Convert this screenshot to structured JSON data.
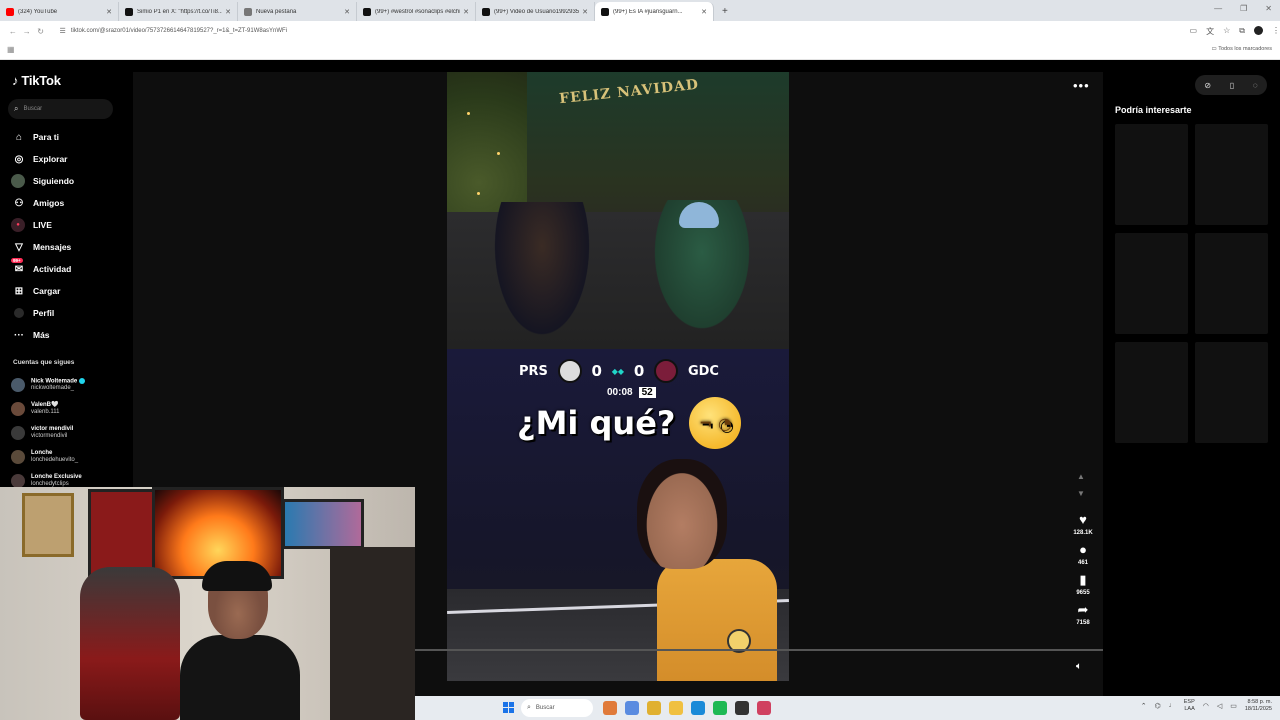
{
  "browser": {
    "tabs": [
      {
        "title": "(324) YouTube",
        "favicon_color": "#ff0000"
      },
      {
        "title": "Simio P1 en X: \"https://t.co/Ti8...",
        "favicon_color": "#111111"
      },
      {
        "title": "Nueva pestaña",
        "favicon_color": "#777777"
      },
      {
        "title": "(99+) #westrol #sonaclips #elchi...",
        "favicon_color": "#111111"
      },
      {
        "title": "(99+) Video de Usuario1992935...",
        "favicon_color": "#111111"
      },
      {
        "title": "(99+) Es IA #juansguarn...",
        "favicon_color": "#111111"
      }
    ],
    "url": "tiktok.com/@srazor01/video/7573726614647819527?_r=1&_t=ZT-91W8asYnWFi",
    "bookmarks_all": "Todos los marcadores"
  },
  "tiktok": {
    "logo": "TikTok",
    "search_placeholder": "Buscar",
    "nav": [
      {
        "label": "Para ti",
        "icon": "home-icon"
      },
      {
        "label": "Explorar",
        "icon": "compass-icon"
      },
      {
        "label": "Siguiendo",
        "icon": "avatar"
      },
      {
        "label": "Amigos",
        "icon": "friends-icon"
      },
      {
        "label": "LIVE",
        "icon": "live-icon"
      },
      {
        "label": "Mensajes",
        "icon": "messages-icon"
      },
      {
        "label": "Actividad",
        "icon": "inbox-icon",
        "badge": "99+"
      },
      {
        "label": "Cargar",
        "icon": "upload-icon"
      },
      {
        "label": "Perfil",
        "icon": "profile-icon"
      },
      {
        "label": "Más",
        "icon": "more-icon"
      }
    ],
    "following_title": "Cuentas que sigues",
    "following": [
      {
        "name": "Nick Woltemade",
        "handle": "nickwoltemade_",
        "verified": true
      },
      {
        "name": "ValenB🤍",
        "handle": "valenb.111",
        "verified": false
      },
      {
        "name": "victor mendivil",
        "handle": "victormendivil",
        "verified": false
      },
      {
        "name": "Lonche",
        "handle": "lonchedehuevito_",
        "verified": false
      },
      {
        "name": "Lonche Exclusive",
        "handle": "lonchedytclips",
        "verified": false
      }
    ],
    "video": {
      "banner": "FELIZ NAVIDAD",
      "score": {
        "home": "PRS",
        "home_goals": "0",
        "away_goals": "0",
        "away": "GDC"
      },
      "clock": "00:08",
      "shot_clock": "52",
      "caption": "¿Mi qué?",
      "progress": 0.0
    },
    "actions": {
      "likes": "128.1K",
      "comments": "461",
      "saves": "9655",
      "shares": "7158"
    },
    "right_title": "Podría interesarte",
    "suggested_count": 6
  },
  "taskbar": {
    "search": "Buscar",
    "lang_top": "ESP",
    "lang_bottom": "LAA",
    "time": "8:58 p. m.",
    "date": "18/11/2025",
    "app_colors": [
      "#e07a3a",
      "#5a8be0",
      "#e0b030",
      "#f0c040",
      "#1a8ad8",
      "#1db954",
      "#333333",
      "#d04060"
    ]
  }
}
